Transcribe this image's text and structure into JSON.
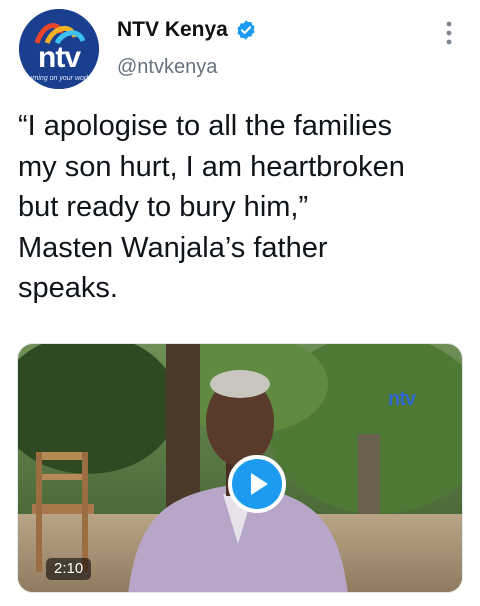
{
  "account": {
    "display_name": "NTV Kenya",
    "handle": "@ntvkenya",
    "avatar_text": "ntv",
    "avatar_tagline": "turning on your world",
    "verified_icon": "verified-badge-icon"
  },
  "tweet": {
    "text": "“I apologise to all the families\nmy son hurt, I am heartbroken\nbut ready to bury him,”\nMasten Wanjala’s father\nspeaks."
  },
  "video": {
    "duration": "2:10",
    "watermark": "ntv",
    "play_icon": "play-icon"
  },
  "colors": {
    "accent": "#1d9bf0",
    "brand": "#1a3f8f",
    "text": "#0f1419",
    "muted": "#66727e"
  }
}
